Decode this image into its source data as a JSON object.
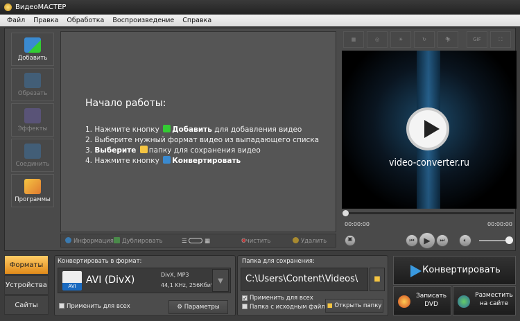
{
  "window": {
    "title": "ВидеоМАСТЕР"
  },
  "menu": [
    "Файл",
    "Правка",
    "Обработка",
    "Воспроизведение",
    "Справка"
  ],
  "sidebar": [
    {
      "label": "Добавить",
      "icon": "film-add-icon",
      "enabled": true
    },
    {
      "label": "Обрезать",
      "icon": "film-cut-icon",
      "enabled": false
    },
    {
      "label": "Эффекты",
      "icon": "effects-icon",
      "enabled": false
    },
    {
      "label": "Соединить",
      "icon": "film-join-icon",
      "enabled": false
    },
    {
      "label": "Программы",
      "icon": "programs-icon",
      "enabled": true
    }
  ],
  "main": {
    "heading": "Начало работы:",
    "steps": [
      {
        "pre": "1. Нажмите кнопку",
        "bold": "Добавить",
        "post": "для добавления видео"
      },
      {
        "pre": "2. Выберите нужный формат видео из выпадающего списка",
        "bold": "",
        "post": ""
      },
      {
        "pre": "3.",
        "bold": "Выберите",
        "post": "папку для сохранения видео"
      },
      {
        "pre": "4. Нажмите кнопку",
        "bold": "Конвертировать",
        "post": ""
      }
    ]
  },
  "listbar": {
    "info": "Информация",
    "duplicate": "Дублировать",
    "clear": "Очистить",
    "delete": "Удалить"
  },
  "effects_toolbar": [
    "crop-icon",
    "stabilize-icon",
    "brightness-icon",
    "rotate-icon",
    "speed-icon",
    "gif-icon",
    "fullscreen-icon"
  ],
  "effects_gif": "GIF",
  "preview": {
    "watermark": "video-converter.ru",
    "time_current": "00:00:00",
    "time_total": "00:00:00",
    "progress": 0,
    "volume": 1.0
  },
  "tabs": [
    {
      "label": "Форматы",
      "active": true
    },
    {
      "label": "Устройства",
      "active": false
    },
    {
      "label": "Сайты",
      "active": false
    }
  ],
  "format": {
    "label": "Конвертировать в формат:",
    "name": "AVI (DivX)",
    "badge": "AVI",
    "codecs": "DivX, MP3",
    "audio": "44,1 KHz, 256Кбит",
    "apply_all": "Применить для всех",
    "apply_all_checked": false,
    "params": "Параметры"
  },
  "folder": {
    "label": "Папка для сохранения:",
    "path": "C:\\Users\\Content\\Videos\\",
    "apply_all": "Применить для всех",
    "apply_all_checked": true,
    "source_folder": "Папка с исходным файлом",
    "source_folder_checked": false,
    "open": "Открыть папку"
  },
  "actions": {
    "convert": "Конвертировать",
    "dvd_1": "Записать",
    "dvd_2": "DVD",
    "upload_1": "Разместить",
    "upload_2": "на сайте"
  },
  "colors": {
    "accent": "#f0a030",
    "brand_blue": "#3a8ad0"
  }
}
